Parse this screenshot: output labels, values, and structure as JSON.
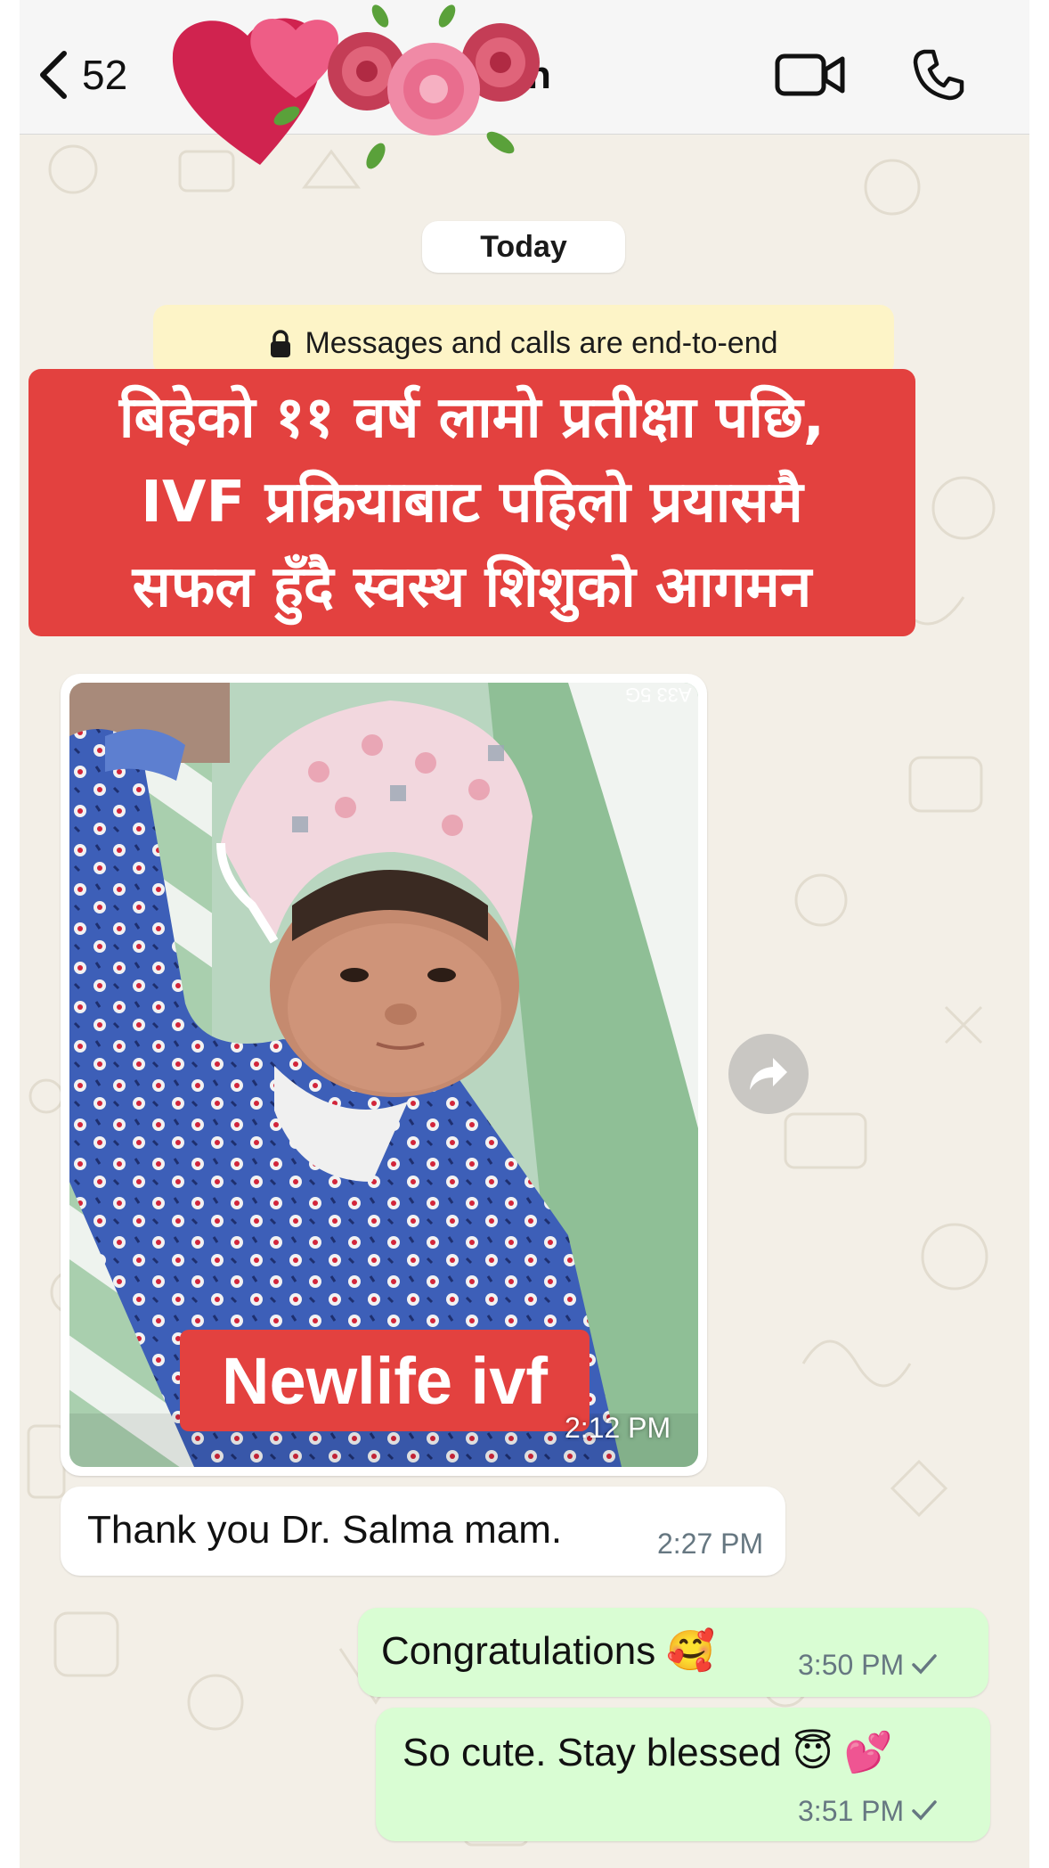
{
  "header": {
    "back_count": "52",
    "contact_name_visible": "n"
  },
  "chat": {
    "date_label": "Today",
    "encryption_notice": "Messages and calls are end-to-end",
    "caption_lines": [
      "बिहेको ११ वर्ष लामो प्रतीक्षा पछि,",
      "IVF प्रक्रियाबाट पहिलो प्रयासमै",
      "सफल हुँदै स्वस्थ शिशुको आगमन"
    ],
    "image_message": {
      "overlay_label": "Newlife ivf",
      "time": "2:12 PM",
      "tag_text": "A33 5G"
    },
    "messages": [
      {
        "direction": "incoming",
        "text": "Thank you Dr. Salma mam.",
        "time": "2:27 PM"
      },
      {
        "direction": "outgoing",
        "text": "Congratulations 🥰",
        "time": "3:50 PM",
        "status": "sent-check"
      },
      {
        "direction": "outgoing",
        "text": "So cute. Stay blessed 😇 💕",
        "time": "3:51 PM",
        "status": "sent-check"
      }
    ]
  },
  "icons": {
    "back": "chevron-left-icon",
    "video": "video-call-icon",
    "phone": "phone-icon",
    "forward": "forward-icon",
    "lock": "lock-icon",
    "check": "check-icon"
  },
  "colors": {
    "chat_bg": "#f3efe7",
    "outgoing_bubble": "#d9fdd3",
    "incoming_bubble": "#ffffff",
    "banner_bg": "#fdf4c7",
    "caption_red": "#e3413f"
  }
}
